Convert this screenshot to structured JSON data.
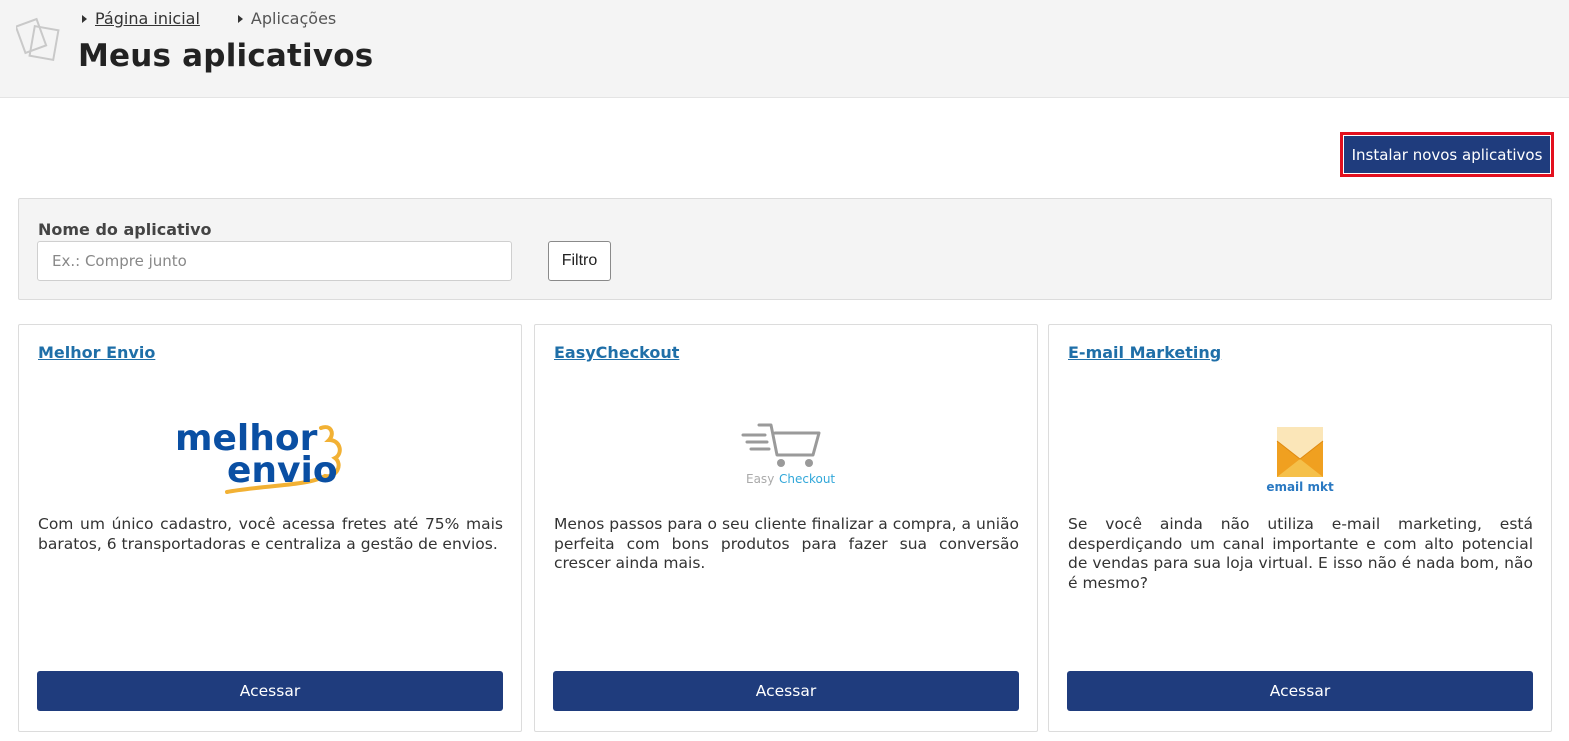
{
  "breadcrumb": {
    "home": "Página inicial",
    "current": "Aplicações"
  },
  "page_title": "Meus aplicativos",
  "install_button": "Instalar novos aplicativos",
  "filter": {
    "label": "Nome do aplicativo",
    "placeholder": "Ex.: Compre junto",
    "button": "Filtro"
  },
  "apps": [
    {
      "title": "Melhor Envio",
      "logo_line1": "melhor",
      "logo_line2": "envio",
      "description": "Com um único cadastro, você acessa fretes até 75% mais baratos, 6 transportadoras e centraliza a gestão de envios.",
      "button": "Acessar"
    },
    {
      "title": "EasyCheckout",
      "logo_easy": "Easy",
      "logo_checkout": "Checkout",
      "description": "Menos passos para o seu cliente finalizar a compra, a união perfeita com bons produtos para fazer sua conversão crescer ainda mais.",
      "button": "Acessar"
    },
    {
      "title": "E-mail Marketing",
      "logo_text": "email mkt",
      "description": "Se você ainda não utiliza e-mail marketing, está desperdiçando um canal importante e com alto potencial de vendas para sua loja virtual. E isso não é nada bom, não é mesmo?",
      "button": "Acessar"
    }
  ],
  "colors": {
    "primary": "#1f3c7d",
    "link": "#1f6fa8",
    "highlight": "#e3101e",
    "melhor_envio_blue": "#0a4fa3",
    "melhor_envio_yellow": "#f2b134",
    "easy_grey": "#9a9a9a",
    "easy_blue": "#31a7d9",
    "email_orange": "#f0a020",
    "email_blue": "#2a79c2"
  },
  "icons": [
    "documents-icon",
    "cart-icon",
    "envelope-icon"
  ]
}
